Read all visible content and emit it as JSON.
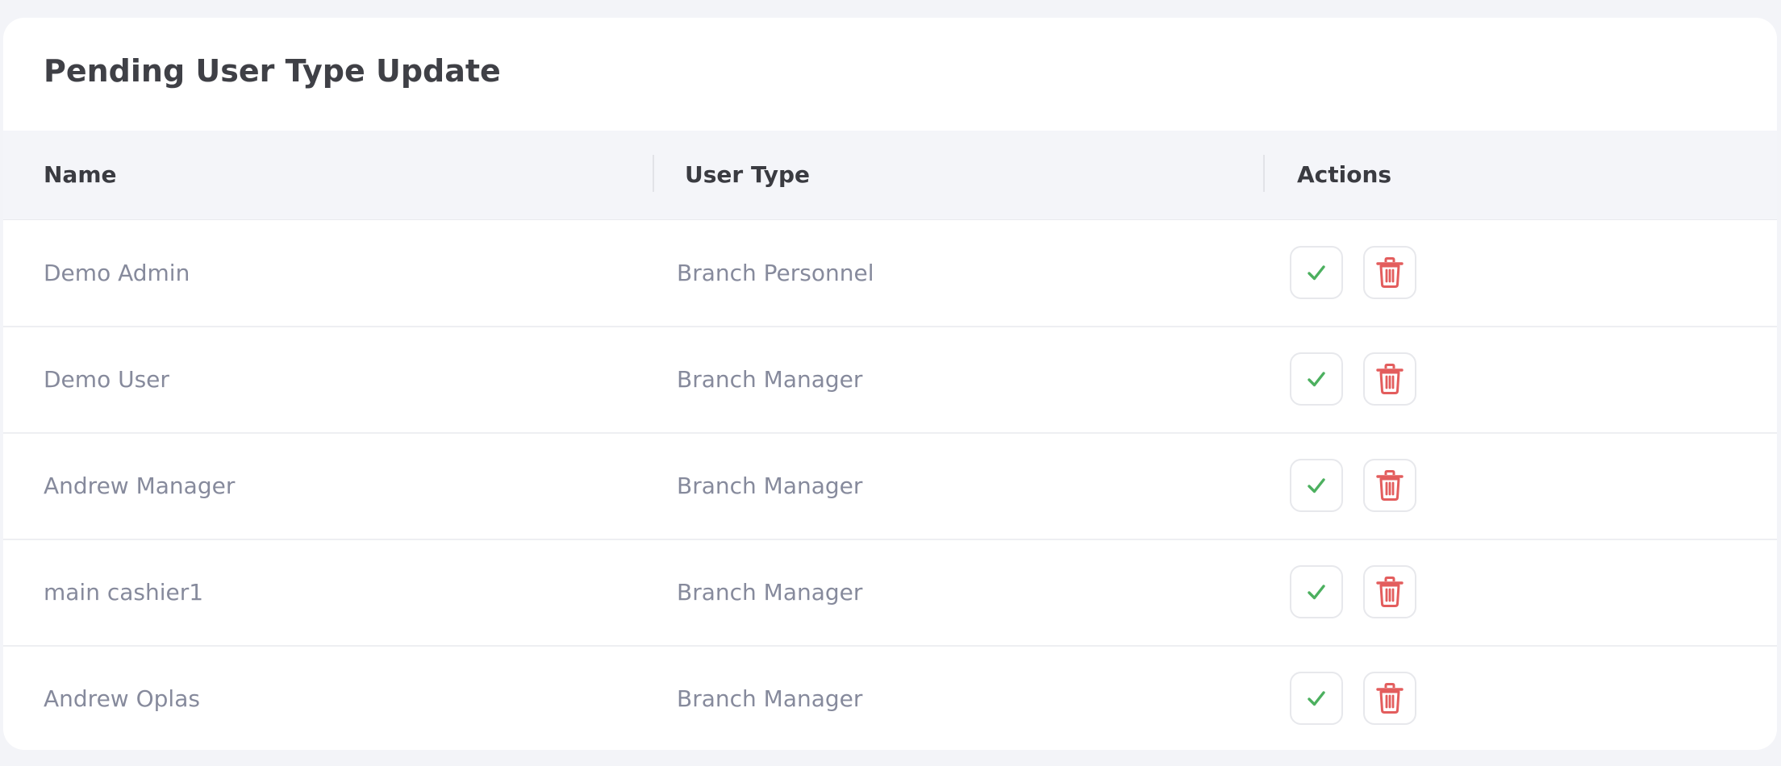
{
  "card": {
    "title": "Pending User Type Update"
  },
  "table": {
    "columns": [
      "Name",
      "User Type",
      "Actions"
    ],
    "rows": [
      {
        "name": "Demo Admin",
        "user_type": "Branch Personnel"
      },
      {
        "name": "Demo User",
        "user_type": "Branch Manager"
      },
      {
        "name": "Andrew Manager",
        "user_type": "Branch Manager"
      },
      {
        "name": "main cashier1",
        "user_type": "Branch Manager"
      },
      {
        "name": "Andrew Oplas",
        "user_type": "Branch Manager"
      }
    ]
  },
  "actions": {
    "approve_icon": "check-icon",
    "delete_icon": "trash-icon"
  },
  "colors": {
    "approve": "#4cb05f",
    "delete": "#e35d5d",
    "header_bg": "#f4f5f9",
    "page_bg": "#f3f4f8"
  }
}
